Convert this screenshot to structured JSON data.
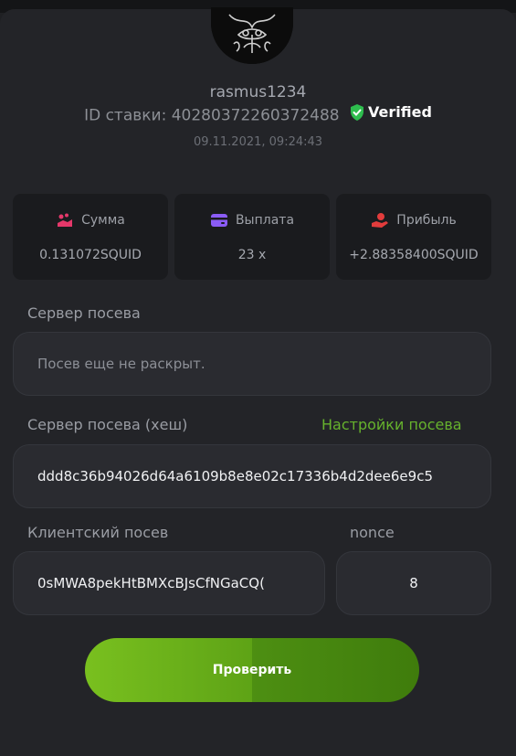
{
  "user": {
    "username": "rasmus1234"
  },
  "bet": {
    "id_label": "ID ставки:",
    "id_value": "40280372260372488",
    "verified_label": "Verified",
    "datetime": "09.11.2021, 09:24:43"
  },
  "stats": [
    {
      "label": "Сумма",
      "value": "0.131072SQUID",
      "icon": "coins-icon",
      "icon_color": "#e5386a"
    },
    {
      "label": "Выплата",
      "value": "23 x",
      "icon": "wallet-icon",
      "icon_color": "#8b5cf6"
    },
    {
      "label": "Прибыль",
      "value": "+2.88358400SQUID",
      "icon": "hand-coin-icon",
      "icon_color": "#e23c3c"
    }
  ],
  "server_seed": {
    "label": "Сервер посева",
    "value": "Посев еще не раскрыт."
  },
  "server_seed_hash": {
    "label": "Сервер посева (хеш)",
    "settings_link": "Настройки посева",
    "value": "ddd8c36b94026d64a6109b8e8e02c17336b4d2dee6e9c5"
  },
  "client_seed": {
    "label": "Клиентский посев",
    "value": "0sMWA8pekHtBMXcBJsCfNGaCQ("
  },
  "nonce": {
    "label": "nonce",
    "value": "8"
  },
  "actions": {
    "verify_label": "Проверить"
  },
  "colors": {
    "accent_green": "#66b22d",
    "verified_shield": "#2ebd4e",
    "background": "#232428"
  }
}
